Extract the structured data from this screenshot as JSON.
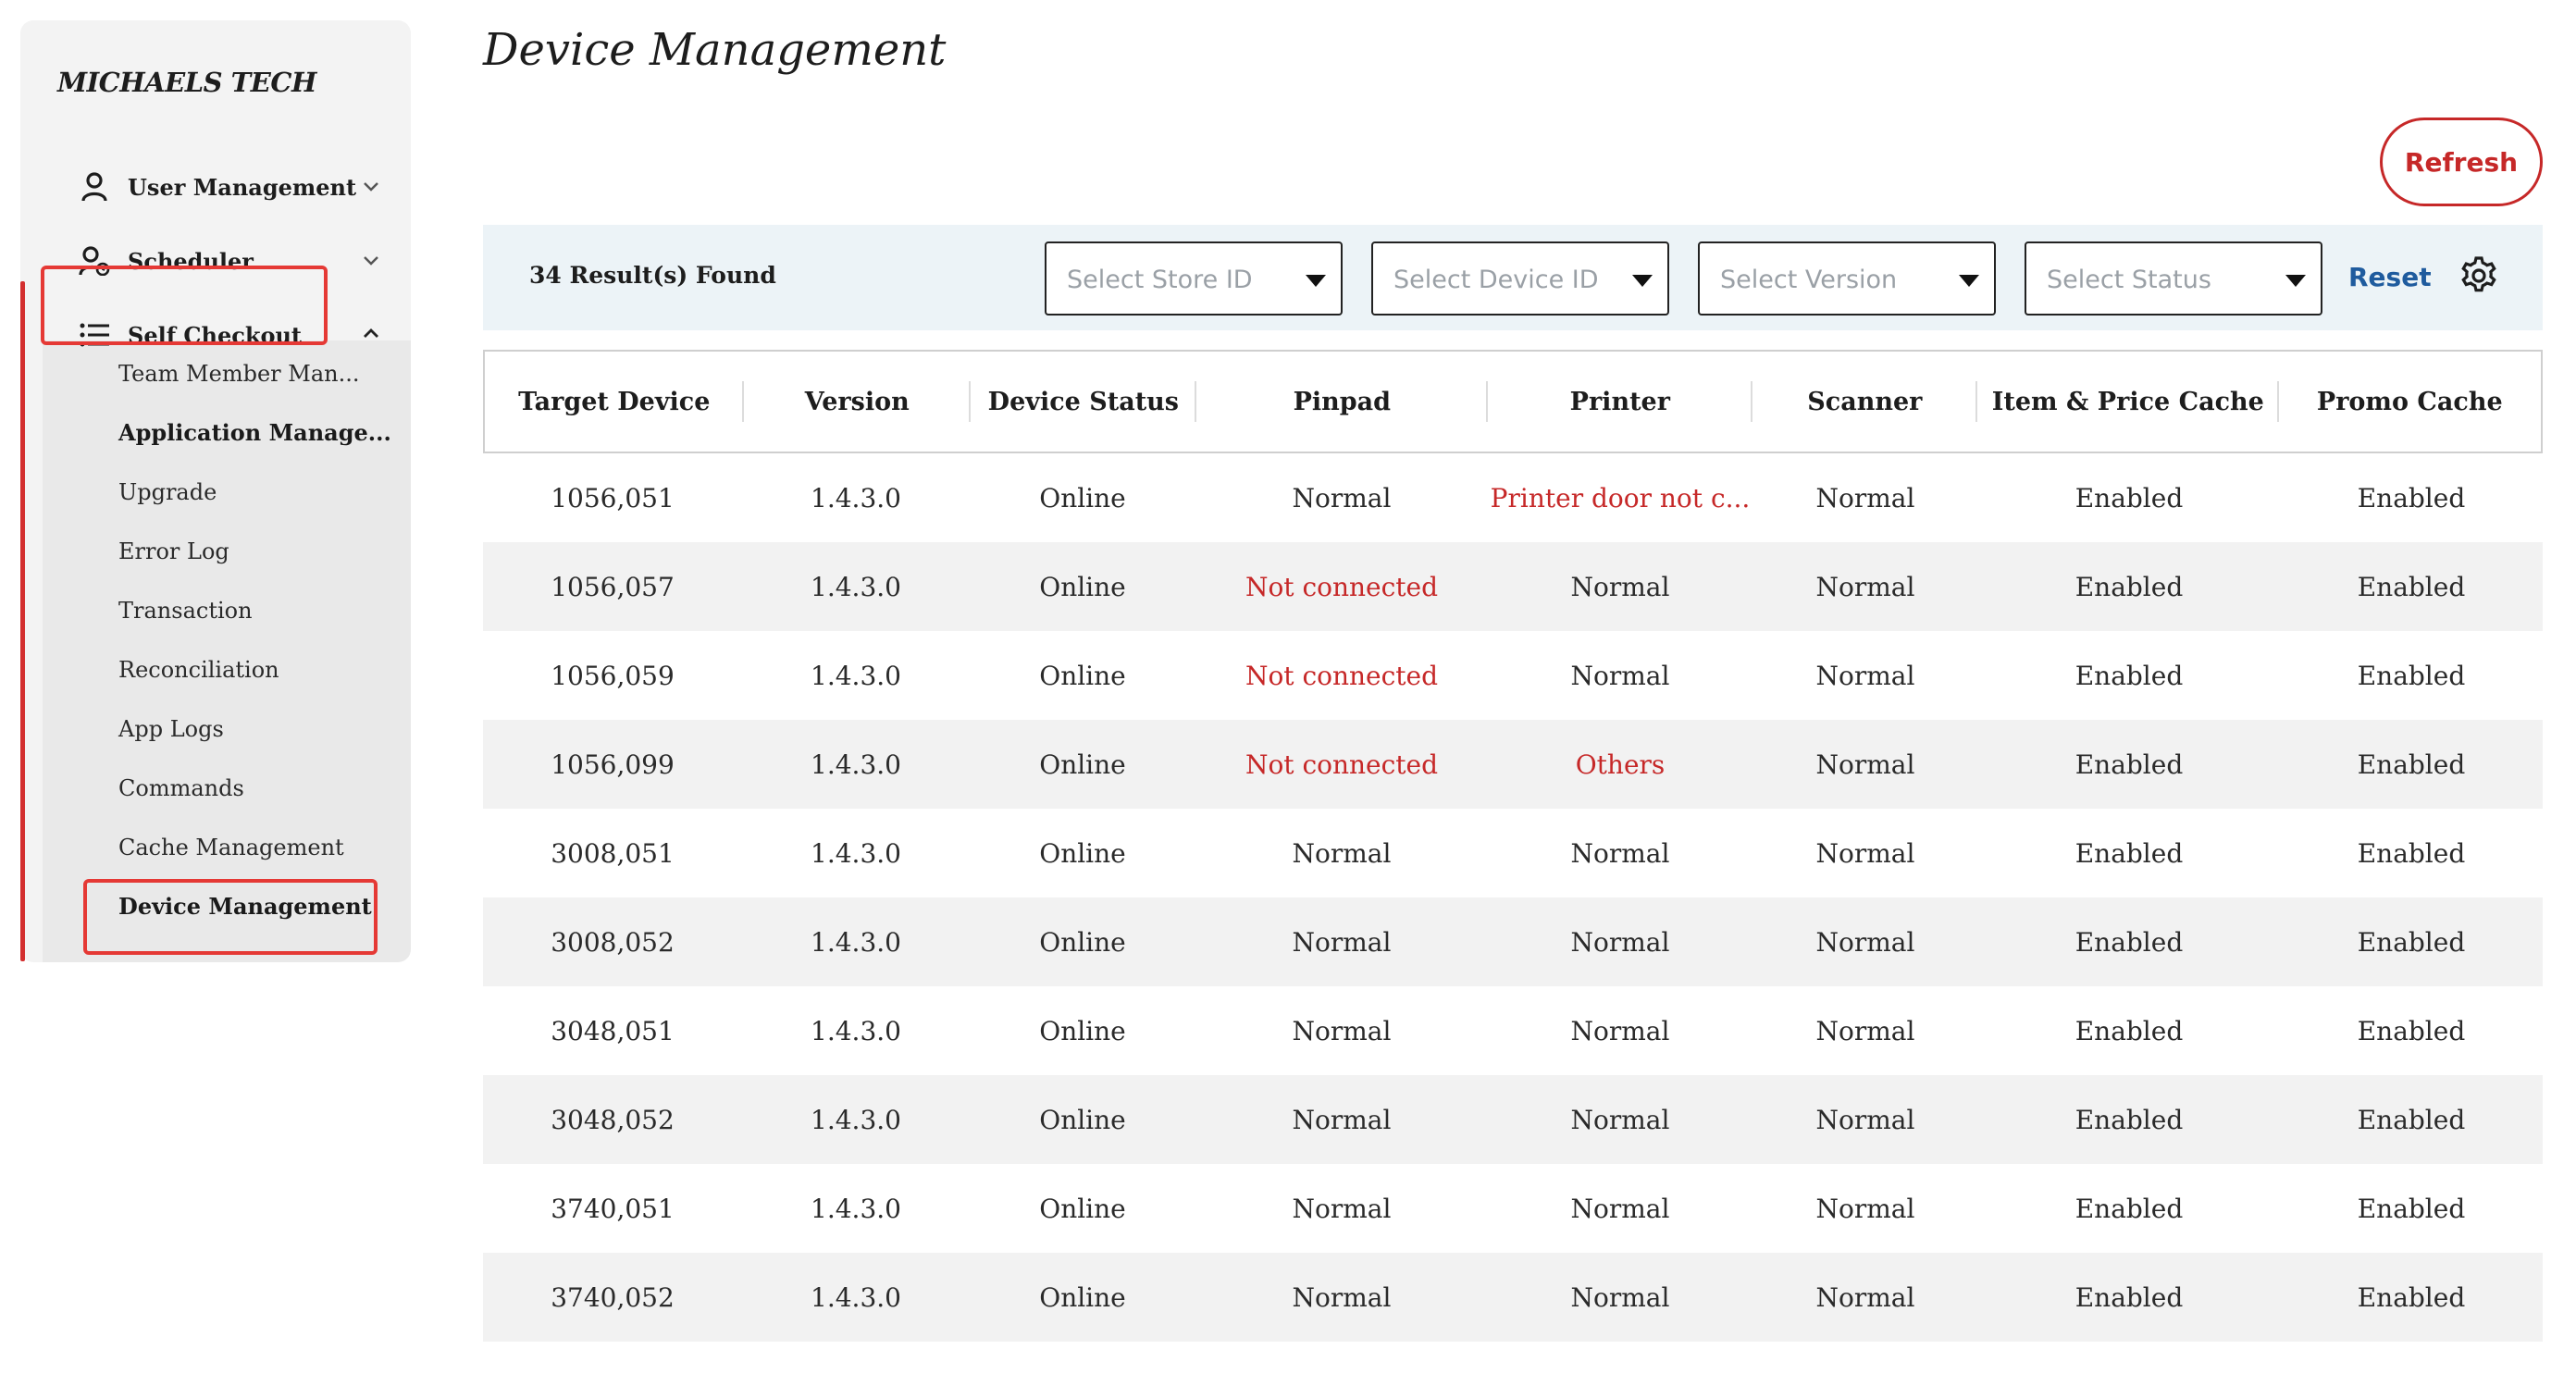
{
  "sidebar": {
    "brand": "MICHAELS TECH",
    "nav": [
      {
        "label": "User Management",
        "icon": "user-icon"
      },
      {
        "label": "Scheduler",
        "icon": "user-clock-icon"
      },
      {
        "label": "Self Checkout",
        "icon": "list-icon"
      }
    ],
    "sub_items": [
      "Team Member Man...",
      "Application Manage...",
      "Upgrade",
      "Error Log",
      "Transaction",
      "Reconciliation",
      "App Logs",
      "Commands",
      "Cache Management",
      "Device Management"
    ]
  },
  "main": {
    "title": "Device Management",
    "refresh_label": "Refresh",
    "results_text": "34 Result(s) Found",
    "filters": {
      "store": "Select Store ID",
      "device": "Select Device ID",
      "version": "Select Version",
      "status": "Select Status"
    },
    "reset_label": "Reset",
    "colors": {
      "accent": "#c62828",
      "link": "#1f5b9e",
      "highlight": "#e53935"
    }
  },
  "table": {
    "headers": [
      "Target Device",
      "Version",
      "Device Status",
      "Pinpad",
      "Printer",
      "Scanner",
      "Item & Price Cache",
      "Promo Cache"
    ],
    "rows": [
      [
        "1056,051",
        "1.4.3.0",
        "Online",
        "Normal",
        "Printer door not c...",
        "Normal",
        "Enabled",
        "Enabled"
      ],
      [
        "1056,057",
        "1.4.3.0",
        "Online",
        "Not connected",
        "Normal",
        "Normal",
        "Enabled",
        "Enabled"
      ],
      [
        "1056,059",
        "1.4.3.0",
        "Online",
        "Not connected",
        "Normal",
        "Normal",
        "Enabled",
        "Enabled"
      ],
      [
        "1056,099",
        "1.4.3.0",
        "Online",
        "Not connected",
        "Others",
        "Normal",
        "Enabled",
        "Enabled"
      ],
      [
        "3008,051",
        "1.4.3.0",
        "Online",
        "Normal",
        "Normal",
        "Normal",
        "Enabled",
        "Enabled"
      ],
      [
        "3008,052",
        "1.4.3.0",
        "Online",
        "Normal",
        "Normal",
        "Normal",
        "Enabled",
        "Enabled"
      ],
      [
        "3048,051",
        "1.4.3.0",
        "Online",
        "Normal",
        "Normal",
        "Normal",
        "Enabled",
        "Enabled"
      ],
      [
        "3048,052",
        "1.4.3.0",
        "Online",
        "Normal",
        "Normal",
        "Normal",
        "Enabled",
        "Enabled"
      ],
      [
        "3740,051",
        "1.4.3.0",
        "Online",
        "Normal",
        "Normal",
        "Normal",
        "Enabled",
        "Enabled"
      ],
      [
        "3740,052",
        "1.4.3.0",
        "Online",
        "Normal",
        "Normal",
        "Normal",
        "Enabled",
        "Enabled"
      ]
    ]
  }
}
